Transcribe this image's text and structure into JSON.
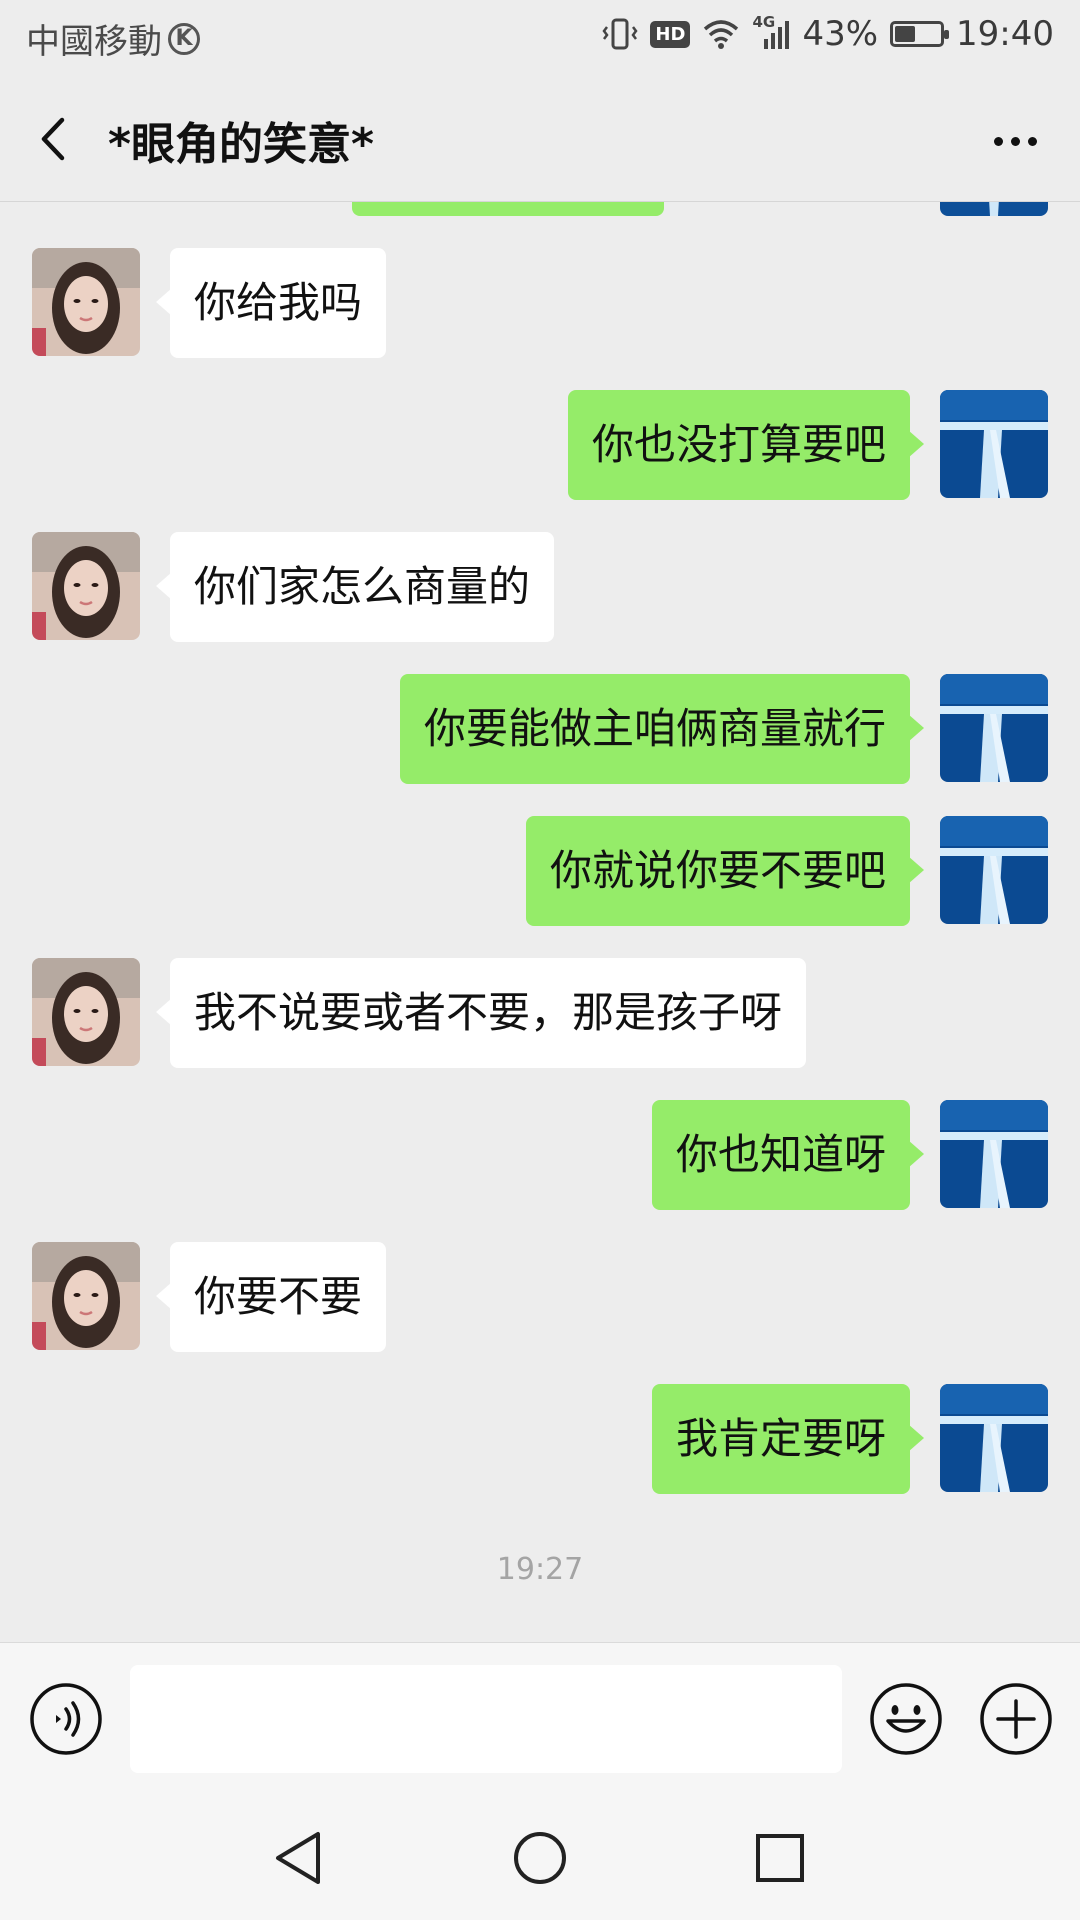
{
  "status_bar": {
    "carrier": "中國移動",
    "carrier_badge": "K",
    "network": "4G",
    "hd": "HD",
    "battery": "43%",
    "time": "19:40"
  },
  "header": {
    "title": "*眼角的笑意*"
  },
  "messages": [
    {
      "side": "left",
      "text": "你给我吗"
    },
    {
      "side": "right",
      "text": "你也没打算要吧"
    },
    {
      "side": "left",
      "text": "你们家怎么商量的"
    },
    {
      "side": "right",
      "text": "你要能做主咱俩商量就行"
    },
    {
      "side": "right",
      "text": "你就说你要不要吧"
    },
    {
      "side": "left",
      "text": "我不说要或者不要，那是孩子呀"
    },
    {
      "side": "right",
      "text": "你也知道呀"
    },
    {
      "side": "left",
      "text": "你要不要"
    },
    {
      "side": "right",
      "text": "我肯定要呀"
    }
  ],
  "timestamp": "19:27",
  "input": {
    "value": "",
    "placeholder": ""
  },
  "icons": {
    "back": "chevron-left-icon",
    "more": "more-horizontal-icon",
    "voice": "voice-icon",
    "emoji": "emoji-icon",
    "plus": "plus-icon",
    "nav_back": "triangle-back-icon",
    "nav_home": "circle-home-icon",
    "nav_recent": "square-recent-icon"
  },
  "colors": {
    "background": "#ededed",
    "sent_bubble": "#95ec69",
    "received_bubble": "#ffffff",
    "timestamp": "#a4a4a4"
  }
}
